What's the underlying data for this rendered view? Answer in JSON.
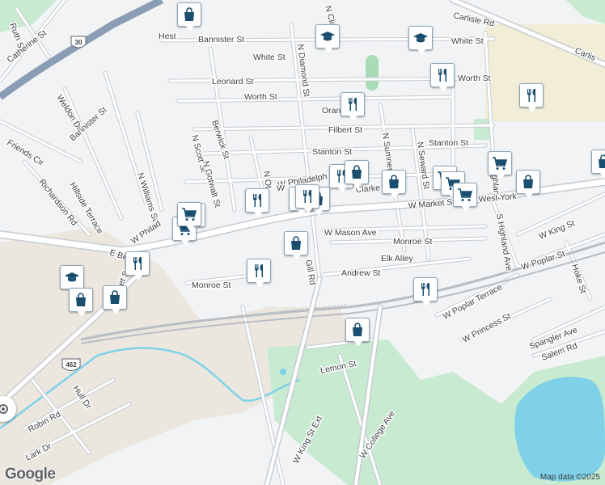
{
  "map": {
    "attribution": "Map data ©2025",
    "logo": "Google",
    "colors": {
      "background": "#f1f3f4",
      "road": "#ffffff",
      "road_casing": "#c6ccd2",
      "highway": "#8a9db5",
      "water": "#7fd1e8",
      "park": "#c7ead0",
      "rail": "#b9bec4",
      "campus": "#f2edd7",
      "industrial": "#ebe7df",
      "poi_icon": "#1a4e6e"
    },
    "streets": [
      "N Clin",
      "Ruth St",
      "Catherine St",
      "Hest",
      "Bannister St",
      "White St",
      "Carlisle Rd",
      "White St",
      "Carlis",
      "N Diamond St",
      "Leonard St",
      "Worth St",
      "Orang",
      "Worth St",
      "Weldon Dr",
      "Bannister St",
      "Friends Cir",
      "Berwick St",
      "Filbert St",
      "Stanton St",
      "Stanton St",
      "N Sumner St",
      "N Seward St",
      "N Highland",
      "N Scott St",
      "N Gotwalt St",
      "N Williams St",
      "Richardson Rd",
      "Hillside Terrace",
      "N Ot",
      "W Philadelph",
      "Clarke Ave",
      "W Market St",
      "West York",
      "W Philad",
      "W Mason Ave",
      "Monroe St",
      "W King St",
      "E Be",
      "W Poplar St",
      "Elk Alley",
      "Andrew St",
      "Hoke St",
      "S Highland Ave",
      "Monroe St",
      "W Poplar Terrace",
      "W Princess St",
      "Spangler Ave",
      "Salem Rd",
      "Lemon St",
      "Hull Dr",
      "Robin Rd",
      "Lark Dr",
      "W King St Ext",
      "W College Ave",
      "Gill Rd",
      "rket S",
      "W"
    ],
    "shields": [
      "30",
      "462"
    ],
    "poi_markers": [
      {
        "type": "shopping",
        "icon": "shopping-bag-icon"
      },
      {
        "type": "school",
        "icon": "graduation-cap-icon"
      },
      {
        "type": "school",
        "icon": "graduation-cap-icon"
      },
      {
        "type": "restaurant",
        "icon": "fork-knife-icon"
      },
      {
        "type": "restaurant",
        "icon": "fork-knife-icon"
      },
      {
        "type": "restaurant",
        "icon": "fork-knife-icon"
      },
      {
        "type": "restaurant",
        "icon": "fork-knife-icon"
      },
      {
        "type": "shopping",
        "icon": "shopping-bag-icon"
      },
      {
        "type": "grocery",
        "icon": "shopping-cart-icon"
      },
      {
        "type": "grocery",
        "icon": "shopping-cart-icon"
      },
      {
        "type": "grocery",
        "icon": "shopping-cart-icon"
      },
      {
        "type": "shopping",
        "icon": "shopping-bag-icon"
      },
      {
        "type": "shopping",
        "icon": "shopping-bag-icon"
      },
      {
        "type": "grocery",
        "icon": "shopping-cart-icon"
      },
      {
        "type": "restaurant",
        "icon": "fork-knife-icon"
      },
      {
        "type": "shopping",
        "icon": "shopping-bag-icon"
      },
      {
        "type": "restaurant",
        "icon": "fork-knife-icon"
      },
      {
        "type": "shopping",
        "icon": "shopping-bag-icon"
      },
      {
        "type": "grocery",
        "icon": "shopping-cart-icon"
      },
      {
        "type": "grocery",
        "icon": "shopping-cart-icon"
      },
      {
        "type": "restaurant",
        "icon": "fork-knife-icon"
      },
      {
        "type": "school",
        "icon": "graduation-cap-icon"
      },
      {
        "type": "shopping",
        "icon": "shopping-bag-icon"
      },
      {
        "type": "shopping",
        "icon": "shopping-bag-icon"
      },
      {
        "type": "restaurant",
        "icon": "fork-knife-icon"
      },
      {
        "type": "shopping",
        "icon": "shopping-bag-icon"
      },
      {
        "type": "restaurant",
        "icon": "fork-knife-icon"
      },
      {
        "type": "shopping",
        "icon": "shopping-bag-icon"
      },
      {
        "type": "restaurant",
        "icon": "fork-knife-icon"
      },
      {
        "type": "shopping",
        "icon": "shopping-bag-icon"
      }
    ]
  }
}
